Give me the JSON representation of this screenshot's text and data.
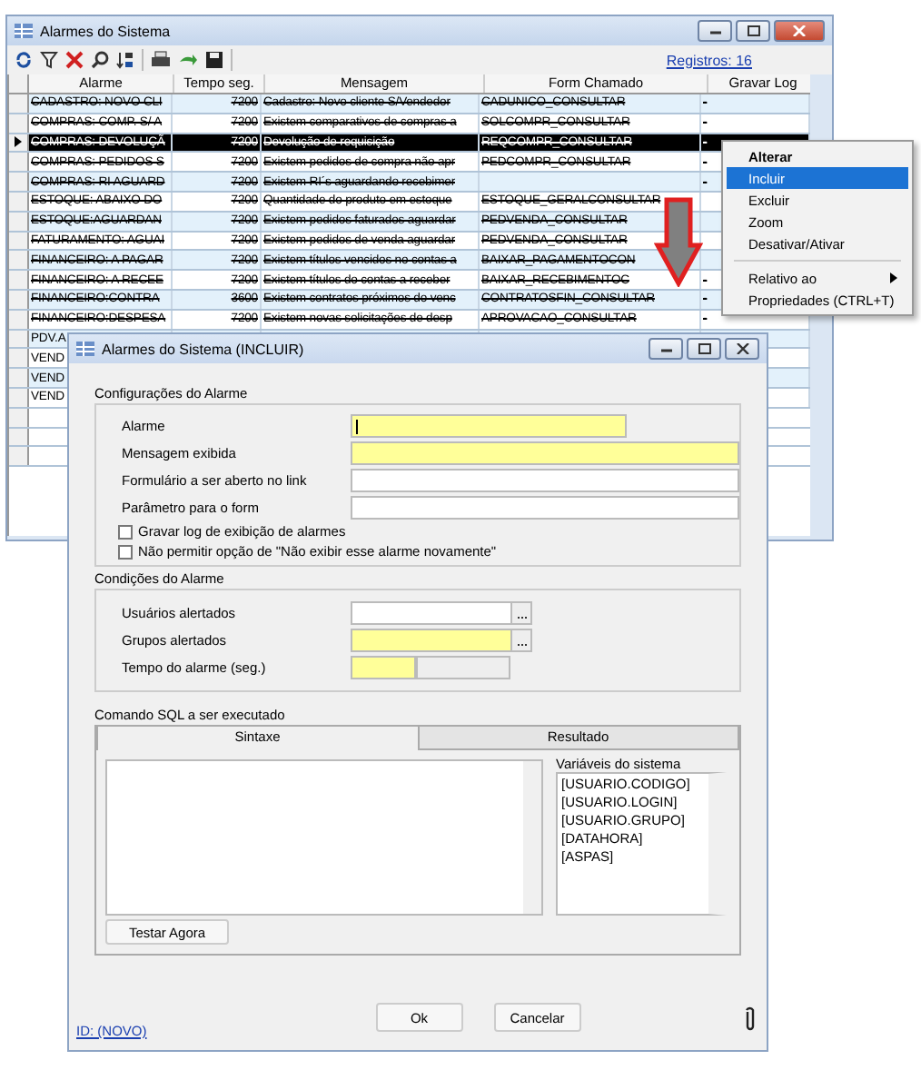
{
  "main_window": {
    "title": "Alarmes do Sistema",
    "record_count": "Registros: 16",
    "columns": [
      "Alarme",
      "Tempo seg.",
      "Mensagem",
      "Form Chamado",
      "Gravar Log"
    ],
    "rows": [
      {
        "alarm": "CADASTRO: NOVO CLI",
        "time": "7200",
        "message": "Cadastro: Novo cliente S/Vendedor",
        "form": "CADUNICO_CONSULTAR",
        "log": "-",
        "disabled": true,
        "selected": false
      },
      {
        "alarm": "COMPRAS: COMP. S/ A",
        "time": "7200",
        "message": "Existem comparativos de compras a",
        "form": "SOLCOMPR_CONSULTAR",
        "log": "-",
        "disabled": true,
        "selected": false
      },
      {
        "alarm": "COMPRAS: DEVOLUÇÃ",
        "time": "7200",
        "message": "Devolução de requisição",
        "form": "REQCOMPR_CONSULTAR",
        "log": "-",
        "disabled": true,
        "selected": true
      },
      {
        "alarm": "COMPRAS: PEDIDOS S",
        "time": "7200",
        "message": "Existem pedidos de compra não apr",
        "form": "PEDCOMPR_CONSULTAR",
        "log": "-",
        "disabled": true,
        "selected": false
      },
      {
        "alarm": "COMPRAS: RI AGUARD",
        "time": "7200",
        "message": "Existem RI´s aguardando recebimer",
        "log": "-",
        "disabled": true,
        "selected": false
      },
      {
        "alarm": "ESTOQUE: ABAIXO DO",
        "time": "7200",
        "message": "Quantidade do produto em estoque",
        "form": "ESTOQUE_GERALCONSULTAR",
        "disabled": true,
        "selected": false
      },
      {
        "alarm": "ESTOQUE:AGUARDAN",
        "time": "7200",
        "message": "Existem pedidos faturados aguardar",
        "form": "PEDVENDA_CONSULTAR",
        "disabled": true,
        "selected": false
      },
      {
        "alarm": "FATURAMENTO: AGUAI",
        "time": "7200",
        "message": "Existem pedidos de venda aguardar",
        "form": "PEDVENDA_CONSULTAR",
        "disabled": true,
        "selected": false
      },
      {
        "alarm": "FINANCEIRO: A PAGAR",
        "time": "7200",
        "message": "Existem títulos vencidos no contas a",
        "form": "BAIXAR_PAGAMENTOCON",
        "disabled": true,
        "selected": false
      },
      {
        "alarm": "FINANCEIRO: A RECEE",
        "time": "7200",
        "message": "Existem títulos do contas a receber",
        "form": "BAIXAR_RECEBIMENTOC",
        "log": "-",
        "disabled": true,
        "selected": false
      },
      {
        "alarm": "FINANCEIRO:CONTRA",
        "time": "3600",
        "message": "Existem contratos próximos do venc",
        "form": "CONTRATOSFIN_CONSULTAR",
        "log": "-",
        "disabled": true,
        "selected": false
      },
      {
        "alarm": "FINANCEIRO:DESPESA",
        "time": "7200",
        "message": "Existem novas solicitações de desp",
        "form": "APROVACAO_CONSULTAR",
        "log": "-",
        "disabled": true,
        "selected": false
      },
      {
        "alarm": "PDV.A",
        "disabled": false,
        "selected": false
      },
      {
        "alarm": "VEND",
        "disabled": false,
        "selected": false
      },
      {
        "alarm": "VEND",
        "disabled": false,
        "selected": false
      },
      {
        "alarm": "VEND",
        "disabled": false,
        "selected": false
      }
    ]
  },
  "context_menu": [
    {
      "label": "Alterar",
      "kind": "default",
      "selected": false
    },
    {
      "label": "Incluir",
      "kind": "item",
      "selected": true
    },
    {
      "label": "Excluir",
      "kind": "item",
      "selected": false
    },
    {
      "label": "Zoom",
      "kind": "item",
      "selected": false
    },
    {
      "label": "Desativar/Ativar",
      "kind": "item",
      "selected": false
    },
    {
      "kind": "separator"
    },
    {
      "label": "Relativo ao",
      "kind": "submenu",
      "selected": false
    },
    {
      "label": "Propriedades (CTRL+T)",
      "kind": "item",
      "selected": false
    }
  ],
  "dialog": {
    "title": "Alarmes do Sistema (INCLUIR)",
    "config_group": {
      "title": "Configurações do Alarme",
      "fields": [
        {
          "label": "Alarme",
          "required": true,
          "kind": "short"
        },
        {
          "label": "Mensagem exibida",
          "required": true,
          "kind": "long"
        },
        {
          "label": "Formulário a ser aberto no link",
          "required": false,
          "kind": "long"
        },
        {
          "label": "Parâmetro para o form",
          "required": false,
          "kind": "long"
        }
      ],
      "checkboxes": [
        {
          "label": "Gravar log de exibição de alarmes",
          "checked": false
        },
        {
          "label": "Não permitir opção de \"Não exibir esse alarme novamente\"",
          "checked": false
        }
      ]
    },
    "conditions_group": {
      "title": "Condições do Alarme",
      "fields": [
        {
          "label": "Usuários alertados",
          "required": false,
          "kind": "lookup"
        },
        {
          "label": "Grupos alertados",
          "required": true,
          "kind": "lookup"
        },
        {
          "label": "Tempo do alarme (seg.)",
          "required": true,
          "kind": "split"
        }
      ]
    },
    "sql_title": "Comando SQL a ser executado",
    "tabs": [
      {
        "label": "Sintaxe",
        "selected": true
      },
      {
        "label": "Resultado",
        "selected": false
      }
    ],
    "variables_label": "Variáveis do sistema",
    "variables": [
      "[USUARIO.CODIGO]",
      "[USUARIO.LOGIN]",
      "[USUARIO.GRUPO]",
      "[DATAHORA]",
      "[ASPAS]"
    ],
    "test_button": "Testar Agora",
    "ok_button": "Ok",
    "cancel_button": "Cancelar",
    "id_link": "ID: (NOVO)"
  }
}
